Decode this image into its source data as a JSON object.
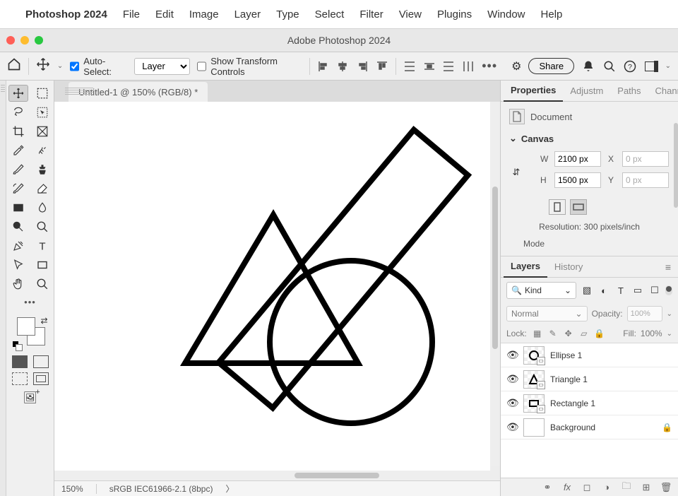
{
  "menu": {
    "app": "Photoshop 2024",
    "items": [
      "File",
      "Edit",
      "Image",
      "Layer",
      "Type",
      "Select",
      "Filter",
      "View",
      "Plugins",
      "Window",
      "Help"
    ]
  },
  "window_title": "Adobe Photoshop 2024",
  "options": {
    "auto_select_label": "Auto-Select:",
    "auto_select_value": "Layer",
    "show_transform_label": "Show Transform Controls",
    "share": "Share"
  },
  "document": {
    "tab": "Untitled-1 @ 150% (RGB/8) *"
  },
  "status": {
    "zoom": "150%",
    "profile": "sRGB IEC61966-2.1 (8bpc)"
  },
  "properties": {
    "tabs": [
      "Properties",
      "Adjustm",
      "Paths",
      "Channe"
    ],
    "doc_label": "Document",
    "canvas_label": "Canvas",
    "W_label": "W",
    "W": "2100 px",
    "H_label": "H",
    "H": "1500 px",
    "X_label": "X",
    "X": "0 px",
    "Y_label": "Y",
    "Y": "0 px",
    "resolution": "Resolution: 300 pixels/inch",
    "mode": "Mode"
  },
  "layers_panel": {
    "tabs": [
      "Layers",
      "History"
    ],
    "kind": "Kind",
    "blend": "Normal",
    "opacity_label": "Opacity:",
    "opacity": "100%",
    "lock_label": "Lock:",
    "fill_label": "Fill:",
    "fill": "100%",
    "layers": [
      {
        "name": "Ellipse 1",
        "type": "shape",
        "locked": false
      },
      {
        "name": "Triangle 1",
        "type": "shape",
        "locked": false
      },
      {
        "name": "Rectangle 1",
        "type": "shape",
        "locked": false
      },
      {
        "name": "Background",
        "type": "bg",
        "locked": true
      }
    ]
  }
}
